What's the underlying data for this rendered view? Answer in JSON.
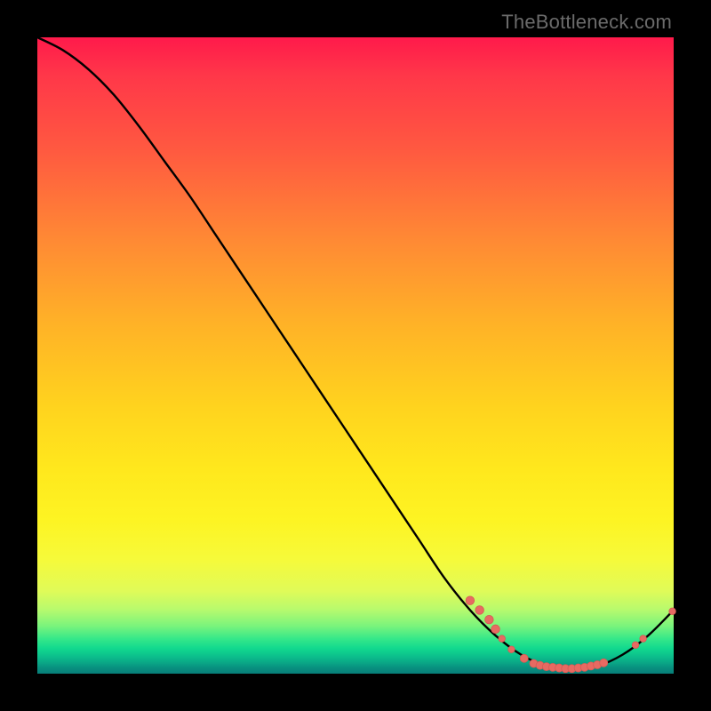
{
  "watermark": "TheBottleneck.com",
  "colors": {
    "background": "#000000",
    "curve": "#000000",
    "marker_fill": "#e76a62",
    "marker_stroke": "#d65a53",
    "gradient_top": "#ff1a4b",
    "gradient_bottom": "#077d79"
  },
  "chart_data": {
    "type": "line",
    "title": "",
    "xlabel": "",
    "ylabel": "",
    "xlim": [
      0,
      100
    ],
    "ylim": [
      0,
      100
    ],
    "grid": false,
    "legend": false,
    "series": [
      {
        "name": "bottleneck-curve",
        "x": [
          0,
          4,
          8,
          12,
          16,
          20,
          24,
          28,
          32,
          36,
          40,
          44,
          48,
          52,
          56,
          60,
          64,
          68,
          72,
          76,
          80,
          84,
          88,
          92,
          96,
          100
        ],
        "y": [
          100,
          98,
          95,
          91,
          86,
          80.5,
          75,
          69,
          63,
          57,
          51,
          45,
          39,
          33,
          27,
          21,
          15,
          10,
          6,
          3,
          1.2,
          0.7,
          1.2,
          3,
          6,
          10
        ]
      }
    ],
    "markers": [
      {
        "x": 68.0,
        "y": 11.5,
        "r": 4.8
      },
      {
        "x": 69.5,
        "y": 10.0,
        "r": 4.8
      },
      {
        "x": 71.0,
        "y": 8.5,
        "r": 4.8
      },
      {
        "x": 72.0,
        "y": 7.0,
        "r": 4.8
      },
      {
        "x": 73.0,
        "y": 5.5,
        "r": 3.8
      },
      {
        "x": 74.5,
        "y": 3.8,
        "r": 3.8
      },
      {
        "x": 76.5,
        "y": 2.4,
        "r": 4.5
      },
      {
        "x": 78.0,
        "y": 1.6,
        "r": 4.5
      },
      {
        "x": 79.0,
        "y": 1.3,
        "r": 4.5
      },
      {
        "x": 80.0,
        "y": 1.1,
        "r": 4.5
      },
      {
        "x": 81.0,
        "y": 1.0,
        "r": 4.5
      },
      {
        "x": 82.0,
        "y": 0.9,
        "r": 4.5
      },
      {
        "x": 83.0,
        "y": 0.8,
        "r": 4.5
      },
      {
        "x": 84.0,
        "y": 0.8,
        "r": 4.5
      },
      {
        "x": 85.0,
        "y": 0.9,
        "r": 4.5
      },
      {
        "x": 86.0,
        "y": 1.0,
        "r": 4.5
      },
      {
        "x": 87.0,
        "y": 1.2,
        "r": 4.5
      },
      {
        "x": 88.0,
        "y": 1.4,
        "r": 4.5
      },
      {
        "x": 89.0,
        "y": 1.7,
        "r": 4.5
      },
      {
        "x": 94.0,
        "y": 4.5,
        "r": 3.8
      },
      {
        "x": 95.2,
        "y": 5.5,
        "r": 3.8
      },
      {
        "x": 99.8,
        "y": 9.8,
        "r": 3.8
      }
    ]
  }
}
